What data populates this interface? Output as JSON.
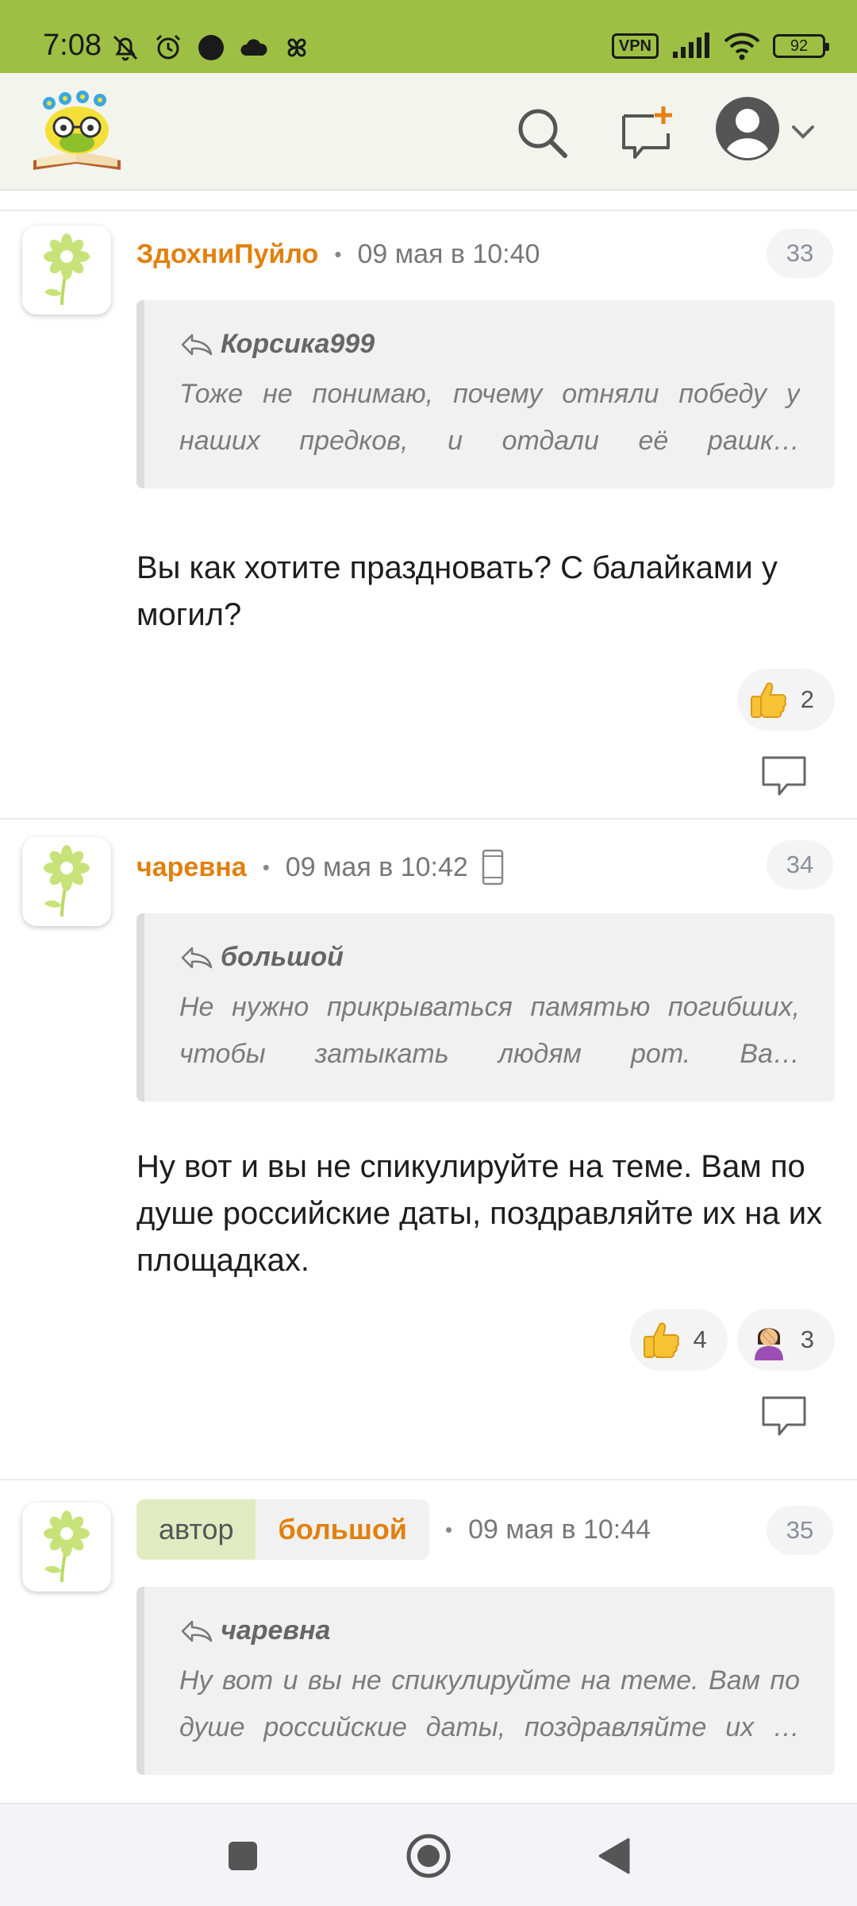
{
  "status_bar": {
    "time": "7:08",
    "vpn_label": "VPN",
    "battery": "92"
  },
  "colors": {
    "status_bar_bg": "#9dc044",
    "username": "#e2800c",
    "author_chip_bg": "#e0ebc2"
  },
  "comments": [
    {
      "username": "ЗдохниПуйло",
      "date": "09 мая в 10:40",
      "number": "33",
      "quote_author": "Корсика999",
      "quote_text": "Тоже не понимаю, почему отняли победу у наших предков, и отдали её рашк…",
      "text": "Вы как хотите праздновать? С балайками у могил?",
      "reactions": [
        {
          "icon": "thumbs-up-icon",
          "count": "2"
        }
      ]
    },
    {
      "username": "чаревна",
      "date": "09 мая в 10:42",
      "number": "34",
      "quote_author": "большой",
      "quote_text": "Не нужно прикрываться памятью погибших, чтобы затыкать людям рот. Ва…",
      "text": "Ну вот и вы не спикулируйте на теме. Вам по душе российские даты, поздравляйте их на их площадках.",
      "reactions": [
        {
          "icon": "thumbs-up-icon",
          "count": "4"
        },
        {
          "icon": "facepalm-icon",
          "count": "3"
        }
      ]
    },
    {
      "author_label": "автор",
      "username": "большой",
      "date": "09 мая в 10:44",
      "number": "35",
      "quote_author": "чаревна",
      "quote_text": "Ну вот и вы не спикулируйте на теме. Вам по душе российские даты, поздравляйте их …"
    }
  ]
}
